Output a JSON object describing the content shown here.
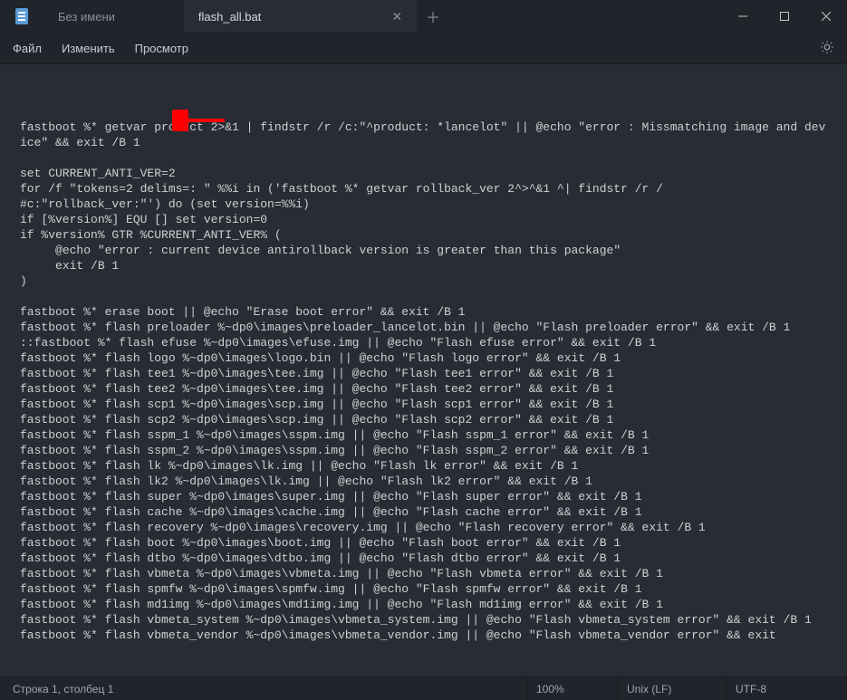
{
  "titlebar": {
    "app_untitled": "Без имени",
    "tabs": [
      {
        "label": "flash_all.bat",
        "active": true
      }
    ]
  },
  "menubar": {
    "file": "Файл",
    "edit": "Изменить",
    "view": "Просмотр"
  },
  "editor_lines": [
    "fastboot %* getvar product 2>&1 | findstr /r /c:\"^product: *lancelot\" || @echo \"error : Missmatching image and device\" && exit /B 1",
    "",
    "set CURRENT_ANTI_VER=2",
    "for /f \"tokens=2 delims=: \" %%i in ('fastboot %* getvar rollback_ver 2^>^&1 ^| findstr /r /",
    "#c:\"rollback_ver:\"') do (set version=%%i)",
    "if [%version%] EQU [] set version=0",
    "if %version% GTR %CURRENT_ANTI_VER% (",
    "     @echo \"error : current device antirollback version is greater than this package\"",
    "     exit /B 1",
    ")",
    "",
    "fastboot %* erase boot || @echo \"Erase boot error\" && exit /B 1",
    "fastboot %* flash preloader %~dp0\\images\\preloader_lancelot.bin || @echo \"Flash preloader error\" && exit /B 1",
    "::fastboot %* flash efuse %~dp0\\images\\efuse.img || @echo \"Flash efuse error\" && exit /B 1",
    "fastboot %* flash logo %~dp0\\images\\logo.bin || @echo \"Flash logo error\" && exit /B 1",
    "fastboot %* flash tee1 %~dp0\\images\\tee.img || @echo \"Flash tee1 error\" && exit /B 1",
    "fastboot %* flash tee2 %~dp0\\images\\tee.img || @echo \"Flash tee2 error\" && exit /B 1",
    "fastboot %* flash scp1 %~dp0\\images\\scp.img || @echo \"Flash scp1 error\" && exit /B 1",
    "fastboot %* flash scp2 %~dp0\\images\\scp.img || @echo \"Flash scp2 error\" && exit /B 1",
    "fastboot %* flash sspm_1 %~dp0\\images\\sspm.img || @echo \"Flash sspm_1 error\" && exit /B 1",
    "fastboot %* flash sspm_2 %~dp0\\images\\sspm.img || @echo \"Flash sspm_2 error\" && exit /B 1",
    "fastboot %* flash lk %~dp0\\images\\lk.img || @echo \"Flash lk error\" && exit /B 1",
    "fastboot %* flash lk2 %~dp0\\images\\lk.img || @echo \"Flash lk2 error\" && exit /B 1",
    "fastboot %* flash super %~dp0\\images\\super.img || @echo \"Flash super error\" && exit /B 1",
    "fastboot %* flash cache %~dp0\\images\\cache.img || @echo \"Flash cache error\" && exit /B 1",
    "fastboot %* flash recovery %~dp0\\images\\recovery.img || @echo \"Flash recovery error\" && exit /B 1",
    "fastboot %* flash boot %~dp0\\images\\boot.img || @echo \"Flash boot error\" && exit /B 1",
    "fastboot %* flash dtbo %~dp0\\images\\dtbo.img || @echo \"Flash dtbo error\" && exit /B 1",
    "fastboot %* flash vbmeta %~dp0\\images\\vbmeta.img || @echo \"Flash vbmeta error\" && exit /B 1",
    "fastboot %* flash spmfw %~dp0\\images\\spmfw.img || @echo \"Flash spmfw error\" && exit /B 1",
    "fastboot %* flash md1img %~dp0\\images\\md1img.img || @echo \"Flash md1img error\" && exit /B 1",
    "fastboot %* flash vbmeta_system %~dp0\\images\\vbmeta_system.img || @echo \"Flash vbmeta_system error\" && exit /B 1",
    "fastboot %* flash vbmeta_vendor %~dp0\\images\\vbmeta_vendor.img || @echo \"Flash vbmeta_vendor error\" && exit"
  ],
  "statusbar": {
    "position": "Строка 1, столбец 1",
    "zoom": "100%",
    "eol": "Unix (LF)",
    "encoding": "UTF-8"
  },
  "annotation_arrow": {
    "target": "set CURRENT_ANTI_VER=2",
    "color": "#ff0000"
  }
}
